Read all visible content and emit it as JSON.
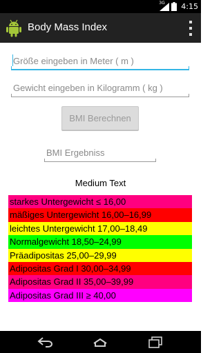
{
  "status_bar": {
    "network": "3G",
    "time": "4:15"
  },
  "action_bar": {
    "title": "Body Mass Index",
    "icons": {
      "app": "android-icon",
      "overflow": "overflow-menu-icon"
    }
  },
  "form": {
    "height_hint": "Größe eingeben in Meter ( m )",
    "weight_hint": "Gewicht eingeben in Kilogramm ( kg )",
    "calculate_button": "BMI Berechnen",
    "result_hint": "BMI Ergebniss"
  },
  "medium_text": "Medium Text",
  "bmi_categories": [
    {
      "label": "starkes Untergewicht ≤ 16,00",
      "color": "#ff0080"
    },
    {
      "label": "mäßiges Untergewicht 16,00–16,99",
      "color": "#ff0000"
    },
    {
      "label": "leichtes Untergewicht 17,00–18,49",
      "color": "#ffff00"
    },
    {
      "label": "Normalgewicht  18,50–24,99",
      "color": "#00ff00"
    },
    {
      "label": "Präadipositas 25,00–29,99",
      "color": "#ffff00"
    },
    {
      "label": "Adipositas Grad I 30,00–34,99",
      "color": "#ff0000"
    },
    {
      "label": "Adipositas Grad II 35,00–39,99",
      "color": "#ff0080"
    },
    {
      "label": "Adipositas Grad III ≥ 40,00",
      "color": "#ff00ff"
    }
  ],
  "nav_bar": {
    "icons": [
      "back-icon",
      "home-icon",
      "recent-apps-icon"
    ]
  }
}
